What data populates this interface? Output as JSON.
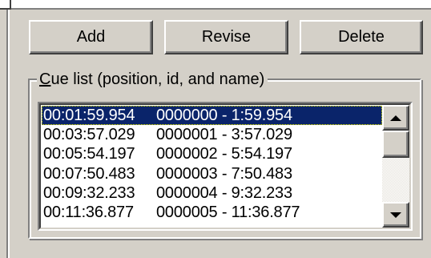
{
  "buttons": {
    "add": "Add",
    "revise": "Revise",
    "delete": "Delete"
  },
  "cue_group": {
    "label_mnemonic": "C",
    "label_rest": "ue list (position, id, and name)"
  },
  "cue_list": {
    "selected_index": 0,
    "rows": [
      {
        "position": "00:01:59.954",
        "id_name": "0000000 - 1:59.954"
      },
      {
        "position": "00:03:57.029",
        "id_name": "0000001 - 3:57.029"
      },
      {
        "position": "00:05:54.197",
        "id_name": "0000002 - 5:54.197"
      },
      {
        "position": "00:07:50.483",
        "id_name": "0000003 - 7:50.483"
      },
      {
        "position": "00:09:32.233",
        "id_name": "0000004 - 9:32.233"
      },
      {
        "position": "00:11:36.877",
        "id_name": "0000005 - 11:36.877"
      }
    ]
  },
  "colors": {
    "face": "#d4d0c8",
    "selection": "#0a246a",
    "selection_text": "#ffffff"
  },
  "icons": {
    "scroll_up": "triangle-up-icon",
    "scroll_down": "triangle-down-icon"
  }
}
